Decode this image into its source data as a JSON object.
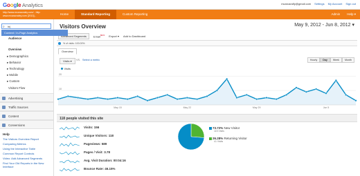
{
  "app": {
    "google": "Google",
    "analytics": "Analytics"
  },
  "top_links": [
    "mcarcaralfy@gmail.com",
    "Settings",
    "My Account",
    "Sign out"
  ],
  "account": {
    "line1": "http://www.mcaracraley.com/ - http:",
    "line2": "www.mcaracraley.com [2013]..."
  },
  "nav": {
    "home": "Home",
    "standard": "Standard Reporting",
    "custom": "Custom Reporting",
    "admin": "Admin",
    "help": "Help"
  },
  "search": {
    "value": "in|",
    "suggestion": "Content / In-Page Analytics"
  },
  "sidebar": {
    "audience": "Audience",
    "overview": "Overview",
    "demographics": "▸ Demographics",
    "behavior": "▸ Behavior",
    "technology": "▸ Technology",
    "mobile": "▸ Mobile",
    "custom": "▸ Custom",
    "visitors_flow": "Visitors Flow",
    "advertising": "Advertising",
    "traffic_sources": "Traffic Sources",
    "content": "Content",
    "conversions": "Conversions"
  },
  "help": {
    "title": "Help",
    "links": [
      "The Visitors Overview Report",
      "Comparing Metrics",
      "Using the Interactive Table",
      "Common Report Controls",
      "Video: Add Advanced Segments",
      "Find Your Old Reports in the New Interface"
    ]
  },
  "main": {
    "title": "Visitors Overview",
    "date_range": "May 9, 2012 - Jun 8, 2012 ▾",
    "toolbar": {
      "segments": "Advanced Segments",
      "email": "Email",
      "beta": "BETA",
      "export": "Export ▾",
      "add_dashboard": "Add to Dashboard"
    },
    "segment_label": "% of visits: 100.00%",
    "tab_overview": "Overview",
    "metric_select": "Visits ▾",
    "vs": "VS.",
    "select_metric": "Select a metric",
    "granularity": [
      "Hourly",
      "Day",
      "Week",
      "Month"
    ],
    "legend": "Visits",
    "summary_title": "118 people visited this site"
  },
  "chart_data": {
    "type": "area",
    "series": [
      {
        "name": "Visits",
        "values": [
          4,
          6,
          5,
          4,
          5,
          4,
          5,
          4,
          6,
          3,
          5,
          7,
          4,
          5,
          4,
          6,
          10,
          18,
          5,
          7,
          4,
          5,
          4,
          7,
          12,
          9,
          11,
          8,
          17,
          7,
          3
        ]
      }
    ],
    "x_ticks": [
      "May 15",
      "May 22",
      "May 29",
      "Jun 5"
    ],
    "y_ticks": [
      10,
      20
    ],
    "ylim": [
      0,
      22
    ],
    "color": "#058dc7"
  },
  "metrics": [
    {
      "label": "Visits:",
      "value": "156"
    },
    {
      "label": "Unique Visitors:",
      "value": "118"
    },
    {
      "label": "Pageviews:",
      "value": "589"
    },
    {
      "label": "Pages / Visit:",
      "value": "3.78"
    },
    {
      "label": "Avg. Visit Duration:",
      "value": "00:04:16"
    },
    {
      "label": "Bounce Rate:",
      "value": "46.15%"
    }
  ],
  "pie": {
    "new_pct": "73.72%",
    "new_label": "New Visitor",
    "new_count": "115 Visits",
    "new_value": 73.72,
    "new_color": "#058dc7",
    "ret_pct": "26.28%",
    "ret_label": "Returning Visitor",
    "ret_count": "41 Visits",
    "ret_value": 26.28,
    "ret_color": "#50b432"
  }
}
